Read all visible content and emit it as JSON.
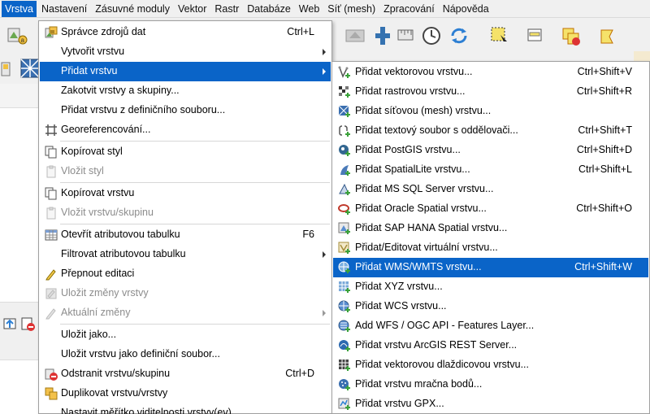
{
  "menubar": {
    "items": [
      {
        "label": "Vrstva",
        "active": true
      },
      {
        "label": "Nastavení"
      },
      {
        "label": "Zásuvné moduly"
      },
      {
        "label": "Vektor"
      },
      {
        "label": "Rastr"
      },
      {
        "label": "Databáze"
      },
      {
        "label": "Web"
      },
      {
        "label": "Síť (mesh)"
      },
      {
        "label": "Zpracování"
      },
      {
        "label": "Nápověda"
      }
    ]
  },
  "layer_menu": {
    "items": [
      {
        "label": "Správce zdrojů dat",
        "shortcut": "Ctrl+L",
        "icon": "data-source-manager-icon"
      },
      {
        "label": "Vytvořit vrstvu",
        "submenu": true
      },
      {
        "label": "Přidat vrstvu",
        "submenu": true,
        "highlighted": true
      },
      {
        "label": "Zakotvit vrstvy a skupiny..."
      },
      {
        "label": "Přidat vrstvu z definičního souboru..."
      },
      {
        "label": "Georeferencování...",
        "icon": "georeferencer-icon"
      },
      {
        "label": "Kopírovat styl",
        "icon": "copy-style-icon"
      },
      {
        "label": "Vložit styl",
        "disabled": true,
        "icon": "paste-style-icon"
      },
      {
        "label": "Kopírovat vrstvu",
        "icon": "copy-layer-icon"
      },
      {
        "label": "Vložit vrstvu/skupinu",
        "disabled": true,
        "icon": "paste-layer-icon"
      },
      {
        "label": "Otevřít atributovou tabulku",
        "shortcut": "F6",
        "icon": "attribute-table-icon"
      },
      {
        "label": "Filtrovat atributovou tabulku",
        "submenu": true
      },
      {
        "label": "Přepnout editaci",
        "icon": "toggle-editing-icon"
      },
      {
        "label": "Uložit změny vrstvy",
        "disabled": true,
        "icon": "save-edits-icon"
      },
      {
        "label": "Aktuální změny",
        "disabled": true,
        "submenu": true,
        "icon": "current-edits-icon"
      },
      {
        "label": "Uložit jako..."
      },
      {
        "label": "Uložit vrstvu jako definiční soubor..."
      },
      {
        "label": "Odstranit vrstvu/skupinu",
        "shortcut": "Ctrl+D",
        "icon": "remove-layer-icon"
      },
      {
        "label": "Duplikovat vrstvu/vrstvy",
        "icon": "duplicate-layer-icon"
      },
      {
        "label": "Nastavit měřítko viditelnosti vrstvy(ev)"
      }
    ]
  },
  "add_layer_submenu": {
    "items": [
      {
        "label": "Přidat vektorovou vrstvu...",
        "shortcut": "Ctrl+Shift+V",
        "icon": "add-vector-layer-icon"
      },
      {
        "label": "Přidat rastrovou vrstvu...",
        "shortcut": "Ctrl+Shift+R",
        "icon": "add-raster-layer-icon"
      },
      {
        "label": "Přidat síťovou (mesh) vrstvu...",
        "icon": "add-mesh-layer-icon"
      },
      {
        "label": "Přidat textový soubor s oddělovači...",
        "shortcut": "Ctrl+Shift+T",
        "icon": "add-delimited-text-icon"
      },
      {
        "label": "Přidat PostGIS vrstvu...",
        "shortcut": "Ctrl+Shift+D",
        "icon": "add-postgis-layer-icon"
      },
      {
        "label": "Přidat SpatialLite vrstvu...",
        "shortcut": "Ctrl+Shift+L",
        "icon": "add-spatialite-layer-icon"
      },
      {
        "label": "Přidat MS SQL Server vrstvu...",
        "icon": "add-mssql-layer-icon"
      },
      {
        "label": "Přidat Oracle Spatial vrstvu...",
        "shortcut": "Ctrl+Shift+O",
        "icon": "add-oracle-layer-icon"
      },
      {
        "label": "Přidat SAP HANA Spatial vrstvu...",
        "icon": "add-hana-layer-icon"
      },
      {
        "label": "Přidat/Editovat virtuální vrstvu...",
        "icon": "add-virtual-layer-icon"
      },
      {
        "label": "Přidat WMS/WMTS vrstvu...",
        "shortcut": "Ctrl+Shift+W",
        "highlighted": true,
        "icon": "add-wms-layer-icon"
      },
      {
        "label": "Přidat XYZ vrstvu...",
        "icon": "add-xyz-layer-icon"
      },
      {
        "label": "Přidat WCS vrstvu...",
        "icon": "add-wcs-layer-icon"
      },
      {
        "label": "Add WFS / OGC API - Features Layer...",
        "icon": "add-wfs-layer-icon"
      },
      {
        "label": "Přidat vrstvu ArcGIS REST Server...",
        "icon": "add-arcgis-rest-layer-icon"
      },
      {
        "label": "Přidat vektorovou dlaždicovou vrstvu...",
        "icon": "add-vector-tile-layer-icon"
      },
      {
        "label": "Přidat vrstvu mračna bodů...",
        "icon": "add-point-cloud-layer-icon"
      },
      {
        "label": "Přidat vrstvu GPX...",
        "icon": "add-gpx-layer-icon"
      }
    ]
  },
  "colors": {
    "highlight": "#0a64c8",
    "disabled_text": "#8c8c8c"
  }
}
